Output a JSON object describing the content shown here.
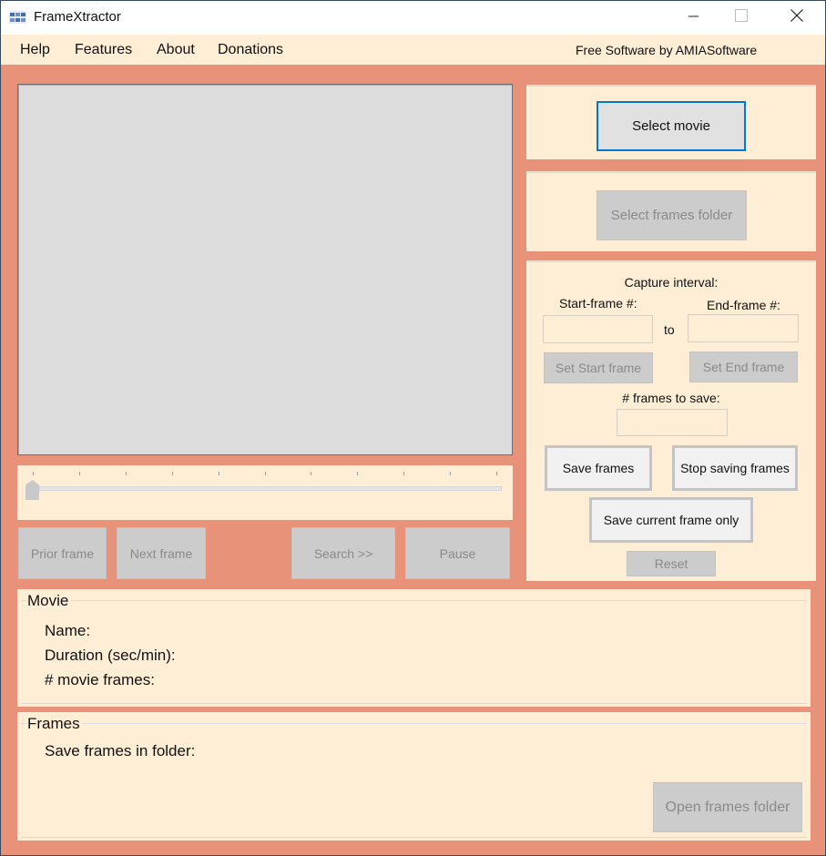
{
  "window": {
    "title": "FrameXtractor",
    "icon": "film-frames-icon",
    "controls": {
      "minimize": "minimize-icon",
      "maximize": "maximize-icon",
      "close": "close-icon"
    }
  },
  "menubar": {
    "items": [
      {
        "label": "Help"
      },
      {
        "label": "Features"
      },
      {
        "label": "About"
      },
      {
        "label": "Donations"
      }
    ],
    "credit": "Free Software by AMIASoftware"
  },
  "video_preview": {
    "state": "empty"
  },
  "slider": {
    "position": 0,
    "tick_count": 11
  },
  "navigation": {
    "prior_frame": "Prior frame",
    "next_frame": "Next frame",
    "search": "Search >>",
    "pause": "Pause"
  },
  "select_movie": {
    "label": "Select movie"
  },
  "select_frames_folder": {
    "label": "Select frames folder"
  },
  "capture": {
    "heading": "Capture interval:",
    "start_label": "Start-frame #:",
    "end_label": "End-frame #:",
    "to_label": "to",
    "start_value": "",
    "end_value": "",
    "set_start": "Set Start frame",
    "set_end": "Set End frame",
    "frames_to_save_label": "# frames to save:",
    "frames_to_save_value": "",
    "save_frames": "Save frames",
    "stop_saving": "Stop saving frames",
    "save_current": "Save current frame only",
    "reset": "Reset"
  },
  "movie_group": {
    "title": "Movie",
    "name_label": "Name:",
    "duration_label": "Duration (sec/min):",
    "frames_label": "# movie frames:"
  },
  "frames_group": {
    "title": "Frames",
    "folder_label": "Save frames in folder:",
    "open_folder": "Open frames folder"
  },
  "colors": {
    "background": "#E8927A",
    "panel": "#FFEED6",
    "focus": "#0078D7",
    "disabled_button": "#CCCCCC"
  }
}
